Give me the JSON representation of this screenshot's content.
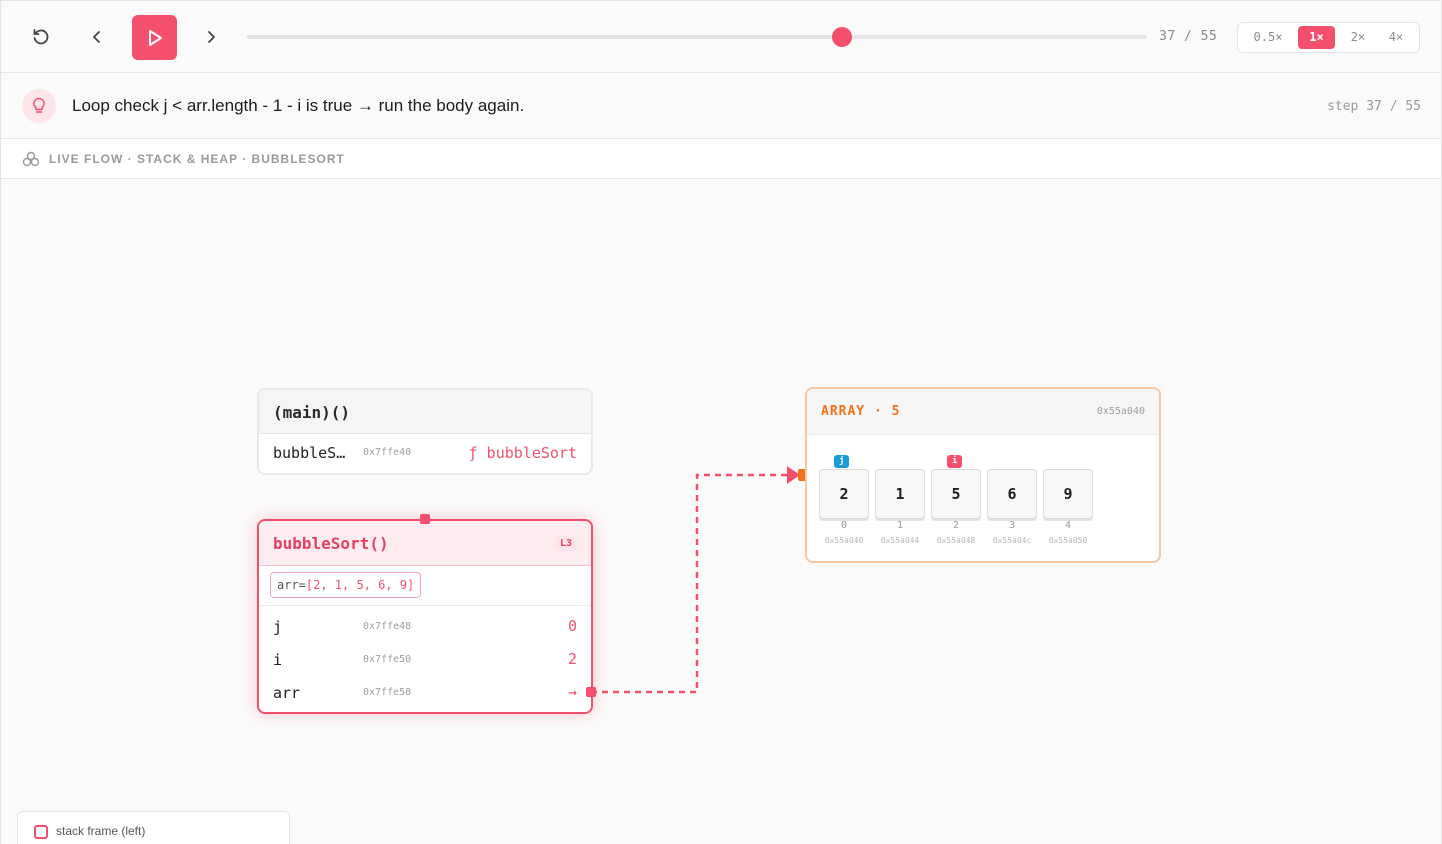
{
  "toolbar": {
    "step_current": "37",
    "step_total": "55",
    "progress_fraction": 0.6607,
    "speeds": [
      "0.5×",
      "1×",
      "2×",
      "4×"
    ],
    "active_speed": "1×",
    "accent_color": "#f4506d"
  },
  "hint": {
    "text": "Loop check j < arr.length - 1 - i is true → run the body again.",
    "step_label": "step 37 / 55",
    "icon": "lightbulb-icon"
  },
  "section": {
    "title": "LIVE FLOW · STACK & HEAP · BUBBLESORT",
    "icon": "network-icon"
  },
  "frames": {
    "main": {
      "title": "(main)()",
      "vars": [
        {
          "name": "bubbleS…",
          "addr": "0x7ffe40",
          "value": "ƒ bubbleSort"
        }
      ]
    },
    "bubbleSort": {
      "title": "bubbleSort()",
      "line_badge": "L3",
      "args_key": "arr=",
      "args_value": "[2, 1, 5, 6, 9]",
      "vars": [
        {
          "name": "j",
          "addr": "0x7ffe48",
          "value": "0"
        },
        {
          "name": "i",
          "addr": "0x7ffe50",
          "value": "2"
        },
        {
          "name": "arr",
          "addr": "0x7ffe58",
          "value": "→"
        }
      ]
    }
  },
  "heap": {
    "title": "ARRAY · 5",
    "addr": "0x55a040",
    "cells": [
      {
        "value": "2",
        "index": "0",
        "addr": "0x55a040"
      },
      {
        "value": "1",
        "index": "1",
        "addr": "0x55a044"
      },
      {
        "value": "5",
        "index": "2",
        "addr": "0x55a048"
      },
      {
        "value": "6",
        "index": "3",
        "addr": "0x55a04c"
      },
      {
        "value": "9",
        "index": "4",
        "addr": "0x55a050"
      }
    ],
    "pointers": [
      {
        "label": "j",
        "index": 0,
        "color": "#1a9bd7"
      },
      {
        "label": "i",
        "index": 2,
        "color": "#f4506d"
      }
    ],
    "accent_color": "#f2711c"
  },
  "legend": {
    "text": "stack frame (left)"
  }
}
